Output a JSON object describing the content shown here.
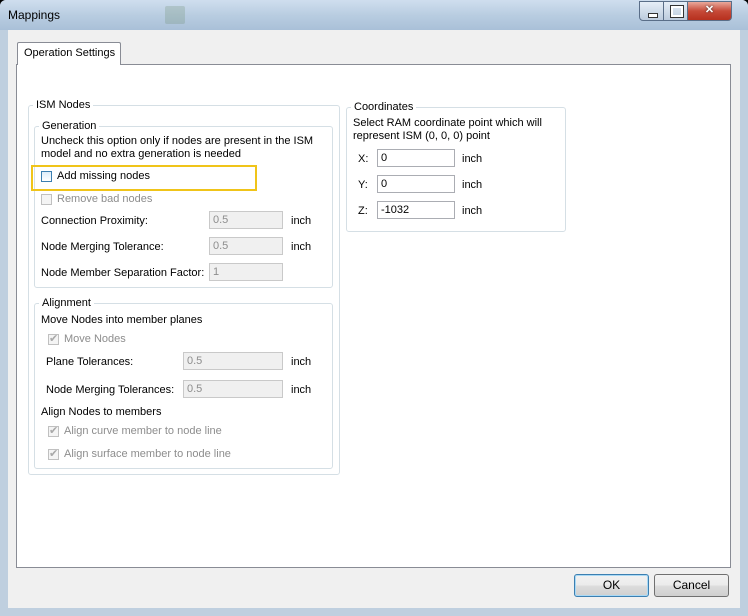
{
  "window": {
    "title": "Mappings"
  },
  "tabs": [
    {
      "label": "Operation Settings"
    }
  ],
  "ism_nodes": {
    "legend": "ISM Nodes",
    "generation": {
      "legend": "Generation",
      "description": "Uncheck this option only if nodes are present in the ISM model and no extra generation is needed",
      "add_missing_nodes": "Add missing nodes",
      "remove_bad_nodes": "Remove bad nodes",
      "connection_proximity": {
        "label": "Connection Proximity:",
        "value": "0.5",
        "unit": "inch"
      },
      "node_merging_tolerance": {
        "label": "Node Merging Tolerance:",
        "value": "0.5",
        "unit": "inch"
      },
      "separation_factor": {
        "label": "Node Member Separation Factor:",
        "value": "1"
      }
    },
    "alignment": {
      "legend": "Alignment",
      "move_heading": "Move Nodes into member planes",
      "move_nodes": "Move Nodes",
      "plane_tolerances": {
        "label": "Plane Tolerances:",
        "value": "0.5",
        "unit": "inch"
      },
      "node_merging_tolerances": {
        "label": "Node Merging Tolerances:",
        "value": "0.5",
        "unit": "inch"
      },
      "align_heading": "Align Nodes to members",
      "align_curve": "Align curve member to node line",
      "align_surface": "Align surface member to node line"
    }
  },
  "coordinates": {
    "legend": "Coordinates",
    "description": "Select RAM coordinate point which will represent ISM (0, 0, 0) point",
    "x": {
      "label": "X:",
      "value": "0",
      "unit": "inch"
    },
    "y": {
      "label": "Y:",
      "value": "0",
      "unit": "inch"
    },
    "z": {
      "label": "Z:",
      "value": "-1032",
      "unit": "inch"
    }
  },
  "buttons": {
    "ok": "OK",
    "cancel": "Cancel"
  },
  "checkbox_states": {
    "add_missing_nodes": false,
    "remove_bad_nodes": false,
    "move_nodes": true,
    "align_curve": true,
    "align_surface": true
  }
}
